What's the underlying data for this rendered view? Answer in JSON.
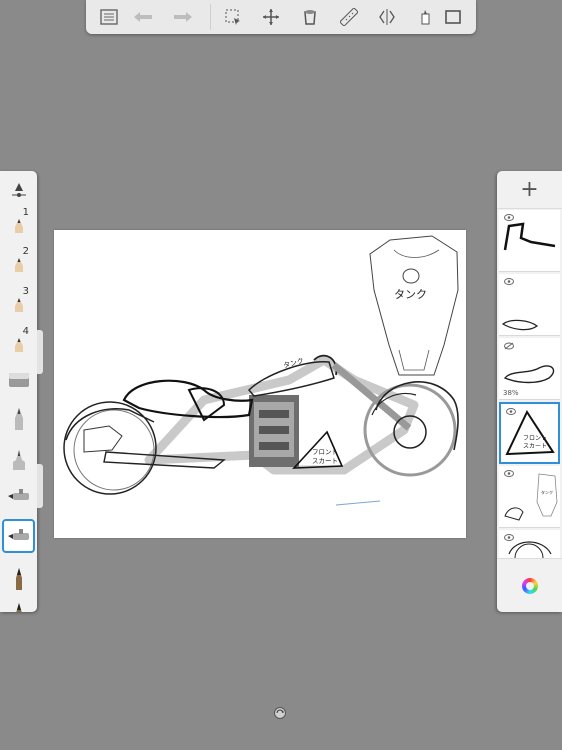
{
  "toolbar": {
    "icons": [
      "list-icon",
      "undo-icon",
      "redo-icon",
      "selection-icon",
      "transform-icon",
      "bucket-fill-icon",
      "ruler-icon",
      "symmetry-icon",
      "brush-properties-icon",
      "fullscreen-icon"
    ]
  },
  "left_panel": {
    "brush_numbers": [
      "1",
      "2",
      "3",
      "4"
    ],
    "tools": [
      "brush-properties-icon",
      "pencil-icon",
      "pencil-icon",
      "pencil-icon",
      "pencil-icon",
      "eraser-icon",
      "ballpoint-icon",
      "felt-pen-icon",
      "airbrush-icon",
      "airbrush-selected-icon",
      "paintbrush-icon",
      "paintbrush-icon"
    ]
  },
  "right_panel": {
    "add_label": "+",
    "layers": [
      {
        "name": "layer-1",
        "visible": true,
        "opacity": ""
      },
      {
        "name": "layer-2",
        "visible": true,
        "opacity": ""
      },
      {
        "name": "layer-3",
        "visible": false,
        "opacity": "38%"
      },
      {
        "name": "layer-4",
        "visible": true,
        "opacity": "",
        "selected": true
      },
      {
        "name": "layer-5",
        "visible": true,
        "opacity": ""
      },
      {
        "name": "layer-6",
        "visible": true,
        "opacity": ""
      }
    ],
    "color_icon": "color-wheel-icon"
  },
  "canvas": {
    "labels": {
      "tank_large": "タンク",
      "tank_small": "タンク",
      "front_skirt_1": "フロント",
      "front_skirt_2": "スカート",
      "layer_thumb_skirt_1": "フロント",
      "layer_thumb_skirt_2": "スカート",
      "layer_thumb_tank": "タンク"
    }
  },
  "colors": {
    "accent": "#2f8fd8",
    "background": "#8a8a8a"
  }
}
